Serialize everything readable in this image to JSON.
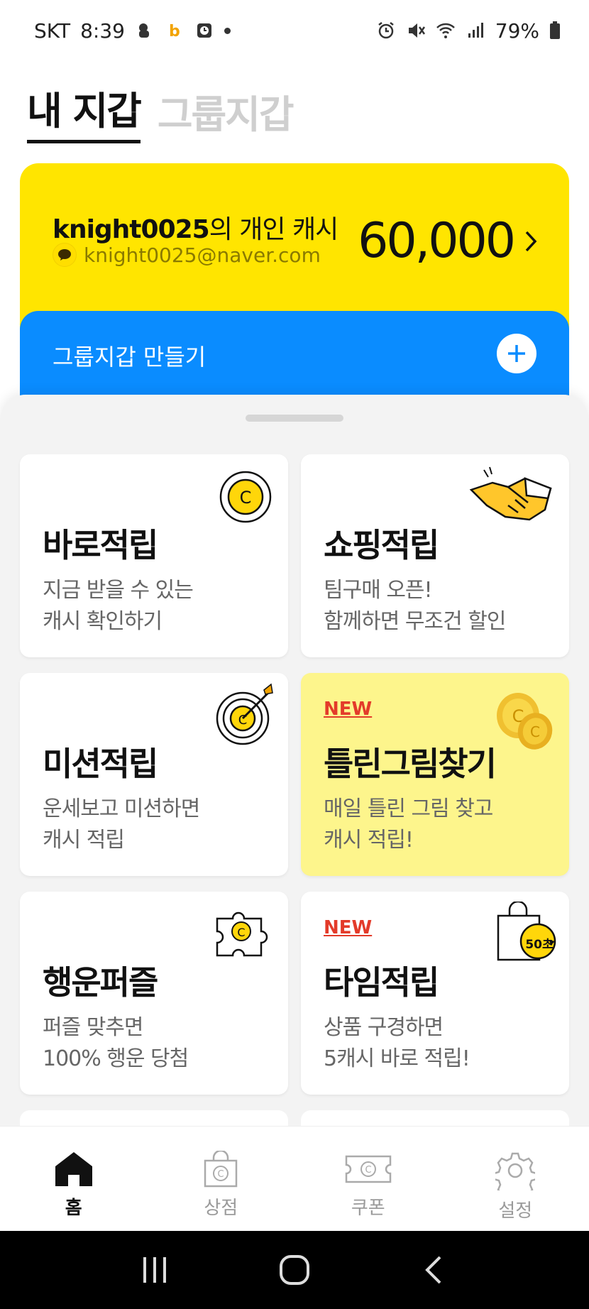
{
  "status_bar": {
    "carrier": "SKT",
    "time": "8:39",
    "battery": "79%"
  },
  "wallet_tabs": {
    "mine": "내 지갑",
    "group": "그룹지갑"
  },
  "cash_card": {
    "owner_name": "knight0025",
    "owner_suffix": "의 개인 캐시",
    "email": "knight0025@naver.com",
    "amount": "60,000"
  },
  "group_card": {
    "label": "그룹지갑 만들기"
  },
  "cards": [
    {
      "title": "바로적립",
      "desc1": "지금 받을 수 있는",
      "desc2": "캐시 확인하기",
      "badge": ""
    },
    {
      "title": "쇼핑적립",
      "desc1": "팀구매 오픈!",
      "desc2": "함께하면 무조건 할인",
      "badge": ""
    },
    {
      "title": "미션적립",
      "desc1": "운세보고 미션하면",
      "desc2": "캐시 적립",
      "badge": ""
    },
    {
      "title": "틀린그림찾기",
      "desc1": "매일 틀린 그림 찾고",
      "desc2": "캐시 적립!",
      "badge": "NEW"
    },
    {
      "title": "행운퍼즐",
      "desc1": "퍼즐 맞추면",
      "desc2": "100% 행운 당첨",
      "badge": ""
    },
    {
      "title": "타임적립",
      "desc1": "상품 구경하면",
      "desc2": "5캐시 바로 적립!",
      "badge": "NEW",
      "timer": "50초"
    }
  ],
  "bottom_nav": {
    "home": "홈",
    "store": "상점",
    "coupon": "쿠폰",
    "settings": "설정"
  },
  "colors": {
    "yellow": "#ffe500",
    "blue": "#0a8cff",
    "highlight": "#fdf58c",
    "new_red": "#e33b2a"
  }
}
